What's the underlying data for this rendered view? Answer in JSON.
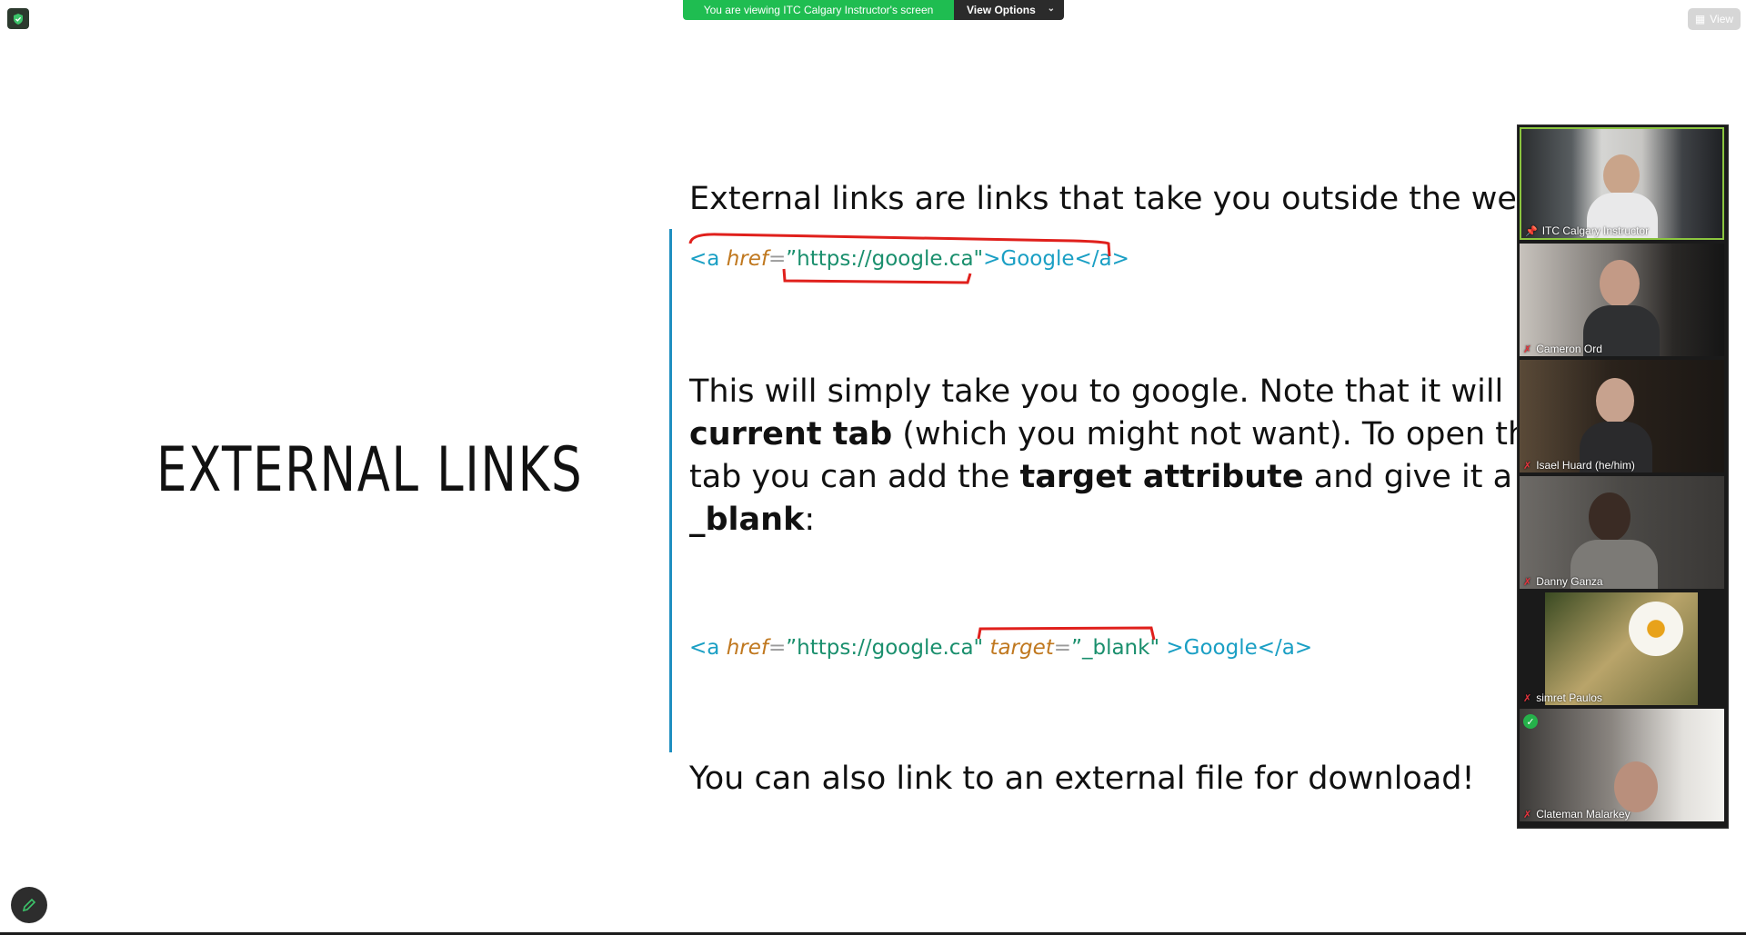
{
  "banner": {
    "status": "You are viewing ITC Calgary Instructor's screen",
    "options": "View Options"
  },
  "view_button": "View",
  "slide": {
    "title": "EXTERNAL LINKS",
    "line1": "External links are links that take you outside the web",
    "code1": {
      "open": "<a ",
      "attr": "href",
      "eq": "=",
      "value": "”https://google.ca\"",
      "close": ">Google</a>"
    },
    "para": {
      "l1": "This will simply take you to google. Note that it will",
      "l2a": "current tab",
      "l2b": " (which you might not want). To open the",
      "l3a": "tab you can add the ",
      "l3b": "target attribute",
      "l3c": " and give it a va",
      "l4a": "_blank",
      "l4b": ":"
    },
    "code2": {
      "open": "<a ",
      "attr1": "href",
      "eq1": "=",
      "value1": "”https://google.ca\" ",
      "attr2": "target",
      "eq2": "=",
      "value2": "”_blank\" ",
      "close": ">Google</a>"
    },
    "line_last": "You can also link to an external file for download!"
  },
  "participants": [
    {
      "name": "ITC Calgary Instructor",
      "pinned": true,
      "muted": false,
      "active": true,
      "bg": "#4a4e50"
    },
    {
      "name": "Cameron Ord",
      "pinned": false,
      "muted": true,
      "active": false,
      "bg": "#3a3634"
    },
    {
      "name": "Isael Huard (he/him)",
      "pinned": false,
      "muted": true,
      "active": false,
      "bg": "#2e2823"
    },
    {
      "name": "Danny Ganza",
      "pinned": false,
      "muted": true,
      "active": false,
      "bg": "#4b4a48"
    },
    {
      "name": "simret Paulos",
      "pinned": false,
      "muted": true,
      "active": false,
      "bg": "#5c5a3a"
    },
    {
      "name": "Clateman Malarkey",
      "pinned": false,
      "muted": true,
      "active": false,
      "bg": "#5d5a55"
    }
  ]
}
